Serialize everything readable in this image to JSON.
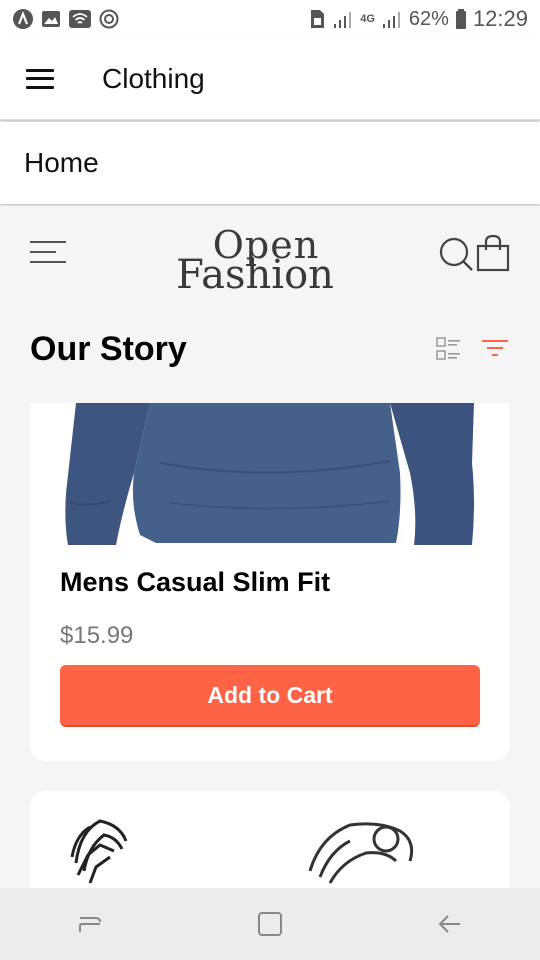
{
  "status_bar": {
    "battery": "62%",
    "time": "12:29",
    "network": "4G",
    "left_icons": [
      "app-a-icon",
      "gallery-icon",
      "wifi-icon",
      "sync-icon"
    ],
    "right_icons": [
      "sim-icon",
      "signal-icon",
      "signal-icon",
      "battery-icon"
    ]
  },
  "app_bar": {
    "title": "Clothing"
  },
  "breadcrumb": {
    "label": "Home"
  },
  "site_header": {
    "logo_line1": "Open",
    "logo_line2": "Fashion"
  },
  "section": {
    "title": "Our Story"
  },
  "products": [
    {
      "name": "Mens Casual Slim Fit",
      "price": "$15.99",
      "button": "Add to Cart",
      "image": "navy long-sleeve shirt"
    },
    {
      "image": "silver chain bracelets"
    }
  ],
  "colors": {
    "accent": "#fe6346",
    "text": "#000000",
    "price": "#777777",
    "background": "#f5f5f6"
  },
  "nav_bar": {
    "buttons": [
      "recent-apps-icon",
      "home-icon",
      "back-icon"
    ]
  }
}
